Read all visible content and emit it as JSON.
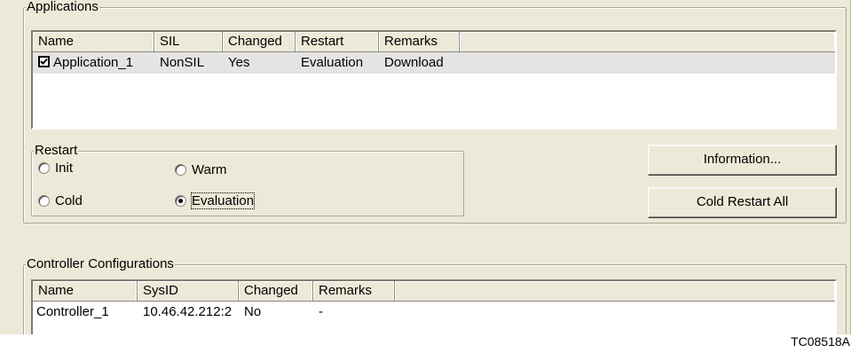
{
  "applications": {
    "title": "Applications",
    "columns": [
      "Name",
      "SIL",
      "Changed",
      "Restart",
      "Remarks"
    ],
    "rows": [
      {
        "checked": true,
        "name": "Application_1",
        "sil": "NonSIL",
        "changed": "Yes",
        "restart": "Evaluation",
        "remarks": "Download"
      }
    ]
  },
  "restart": {
    "title": "Restart",
    "options": [
      "Init",
      "Warm",
      "Cold",
      "Evaluation"
    ],
    "selected": "Evaluation"
  },
  "buttons": {
    "information": "Information...",
    "cold_restart_all": "Cold Restart All"
  },
  "controllers": {
    "title": "Controller Configurations",
    "columns": [
      "Name",
      "SysID",
      "Changed",
      "Remarks"
    ],
    "rows": [
      {
        "name": "Controller_1",
        "sysid": "10.46.42.212:2",
        "changed": "No",
        "remarks": "-"
      }
    ]
  },
  "caption": "TC08518A"
}
